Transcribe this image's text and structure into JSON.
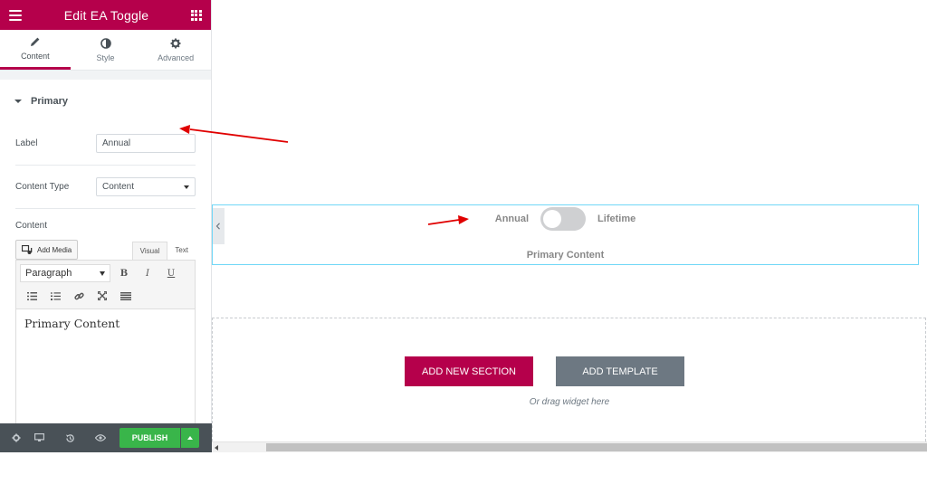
{
  "panel": {
    "title": "Edit EA Toggle",
    "tabs": [
      {
        "label": "Content",
        "icon": "pencil-icon"
      },
      {
        "label": "Style",
        "icon": "half-circle-icon"
      },
      {
        "label": "Advanced",
        "icon": "gear-icon"
      }
    ],
    "section": "Primary",
    "label_field": {
      "label": "Label",
      "value": "Annual"
    },
    "content_type": {
      "label": "Content Type",
      "value": "Content"
    },
    "content_label": "Content",
    "editor": {
      "add_media": "Add Media",
      "visual_tab": "Visual",
      "text_tab": "Text",
      "format": "Paragraph",
      "body": "Primary Content"
    },
    "publish": "PUBLISH"
  },
  "canvas": {
    "toggle": {
      "left_label": "Annual",
      "right_label": "Lifetime",
      "content": "Primary Content"
    },
    "add_section": "ADD NEW SECTION",
    "add_template": "ADD TEMPLATE",
    "drag_hint": "Or drag widget here"
  },
  "colors": {
    "brand": "#b5004b",
    "publish": "#39b54a",
    "annotation_arrow": "#e00000"
  }
}
